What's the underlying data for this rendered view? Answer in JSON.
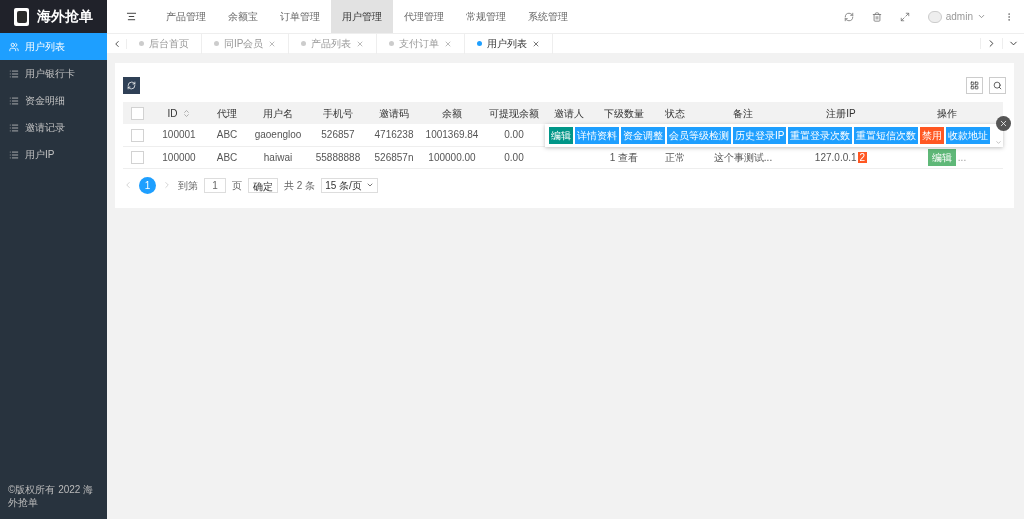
{
  "header": {
    "logo_text": "海外抢单",
    "nav": [
      {
        "label": "产品管理",
        "selected": false
      },
      {
        "label": "余额宝",
        "selected": false
      },
      {
        "label": "订单管理",
        "selected": false
      },
      {
        "label": "用户管理",
        "selected": true
      },
      {
        "label": "代理管理",
        "selected": false
      },
      {
        "label": "常规管理",
        "selected": false
      },
      {
        "label": "系统管理",
        "selected": false
      }
    ],
    "user": "admin"
  },
  "sidebar": {
    "items": [
      {
        "label": "用户列表",
        "selected": true
      },
      {
        "label": "用户银行卡",
        "selected": false
      },
      {
        "label": "资金明细",
        "selected": false
      },
      {
        "label": "邀请记录",
        "selected": false
      },
      {
        "label": "用户IP",
        "selected": false
      }
    ],
    "footer": "©版权所有 2022 海外抢单"
  },
  "tabs": [
    {
      "label": "后台首页",
      "selected": false,
      "closable": false
    },
    {
      "label": "同IP会员",
      "selected": false,
      "closable": true
    },
    {
      "label": "产品列表",
      "selected": false,
      "closable": true
    },
    {
      "label": "支付订单",
      "selected": false,
      "closable": true
    },
    {
      "label": "用户列表",
      "selected": true,
      "closable": true
    }
  ],
  "table": {
    "all_checked": false,
    "columns": [
      {
        "label": "ID",
        "sortable": true
      },
      {
        "label": "代理",
        "sortable": false
      },
      {
        "label": "用户名",
        "sortable": false
      },
      {
        "label": "手机号",
        "sortable": false
      },
      {
        "label": "邀请码",
        "sortable": false
      },
      {
        "label": "余额",
        "sortable": false
      },
      {
        "label": "可提现余额",
        "sortable": false
      },
      {
        "label": "邀请人",
        "sortable": false
      },
      {
        "label": "下级数量",
        "sortable": false
      },
      {
        "label": "状态",
        "sortable": false
      },
      {
        "label": "备注",
        "sortable": false
      },
      {
        "label": "注册IP",
        "sortable": false
      },
      {
        "label": "操作",
        "sortable": false
      }
    ],
    "rows": [
      {
        "checked": false,
        "cells": [
          "100001",
          "ABC",
          "gaoengloo",
          "526857",
          "4716238",
          "1001369.84",
          "0.00"
        ],
        "action_popup": [
          {
            "label": "编辑",
            "kind": "edit"
          },
          {
            "label": "详情资料",
            "kind": "info"
          },
          {
            "label": "资金调整",
            "kind": "info"
          },
          {
            "label": "会员等级检测",
            "kind": "info"
          },
          {
            "label": "历史登录IP",
            "kind": "info"
          },
          {
            "label": "重置登录次数",
            "kind": "info"
          },
          {
            "label": "重置短信次数",
            "kind": "info"
          },
          {
            "label": "禁用",
            "kind": "danger"
          },
          {
            "label": "收款地址",
            "kind": "info"
          }
        ]
      },
      {
        "checked": false,
        "cells": [
          "100000",
          "ABC",
          "haiwai",
          "55888888",
          "526857n",
          "100000.00",
          "0.00",
          "",
          "1 查看",
          "正常",
          "这个事测试...",
          "127.0.0.1"
        ],
        "ip_badge": "2",
        "actions": [
          {
            "label": "编辑",
            "kind": "edit"
          }
        ],
        "more": "..."
      }
    ]
  },
  "pagination": {
    "pages": [
      {
        "label": "1",
        "selected": true
      }
    ],
    "goto_label": "到第",
    "goto_value": "1",
    "page_unit": "页",
    "confirm": "确定",
    "total": "共 2 条",
    "page_size": "15 条/页"
  }
}
